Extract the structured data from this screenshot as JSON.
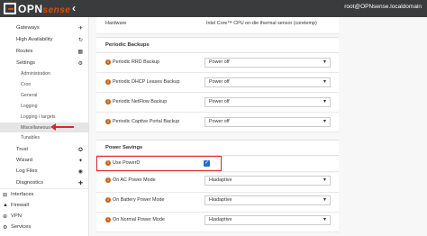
{
  "header": {
    "brand_main": "OPN",
    "brand_sub": "sense",
    "collapse_icon": "chevron-left",
    "user": "root@OPNsense.localdomain"
  },
  "sidebar": {
    "items": [
      {
        "label": "Gateways",
        "icon": "plane"
      },
      {
        "label": "High Availability",
        "icon": "refresh"
      },
      {
        "label": "Routes",
        "icon": "map"
      },
      {
        "label": "Settings",
        "icon": "cogs"
      },
      {
        "label": "Administration"
      },
      {
        "label": "Cron"
      },
      {
        "label": "General"
      },
      {
        "label": "Logging"
      },
      {
        "label": "Logging / targets"
      },
      {
        "label": "Miscellaneous"
      },
      {
        "label": "Tunables"
      },
      {
        "label": "Trust",
        "icon": "certificate"
      },
      {
        "label": "Wizard",
        "icon": "magic"
      },
      {
        "label": "Log Files",
        "icon": "eye"
      },
      {
        "label": "Diagnostics",
        "icon": "medkit"
      },
      {
        "label": "Interfaces",
        "icon": "sitemap"
      },
      {
        "label": "Firewall",
        "icon": "fire"
      },
      {
        "label": "VPN",
        "icon": "globe"
      },
      {
        "label": "Services",
        "icon": "cog"
      }
    ]
  },
  "main": {
    "hardware_label": "Hardware",
    "hardware_value": "Intel Core™ CPU on-die thermal sensor (coretemp)",
    "periodic_backups_title": "Periodic Backups",
    "backups": [
      {
        "label": "Periodic RRD Backup",
        "value": "Power off"
      },
      {
        "label": "Periodic DHCP Leases Backup",
        "value": "Power off"
      },
      {
        "label": "Periodic NetFlow Backup",
        "value": "Power off"
      },
      {
        "label": "Periodic Captive Portal Backup",
        "value": "Power off"
      }
    ],
    "power_savings_title": "Power Savings",
    "use_powerd_label": "Use PowerD",
    "use_powerd_checked": true,
    "power_modes": [
      {
        "label": "On AC Power Mode",
        "value": "Hiadaptive"
      },
      {
        "label": "On Battery Power Mode",
        "value": "Hiadaptive"
      },
      {
        "label": "On Normal Power Mode",
        "value": "Hiadaptive"
      }
    ]
  },
  "colors": {
    "topbar": "#3a3b3d",
    "accent": "#d94f00",
    "annotation": "#d9262e",
    "checkbox": "#1f6fd6"
  }
}
